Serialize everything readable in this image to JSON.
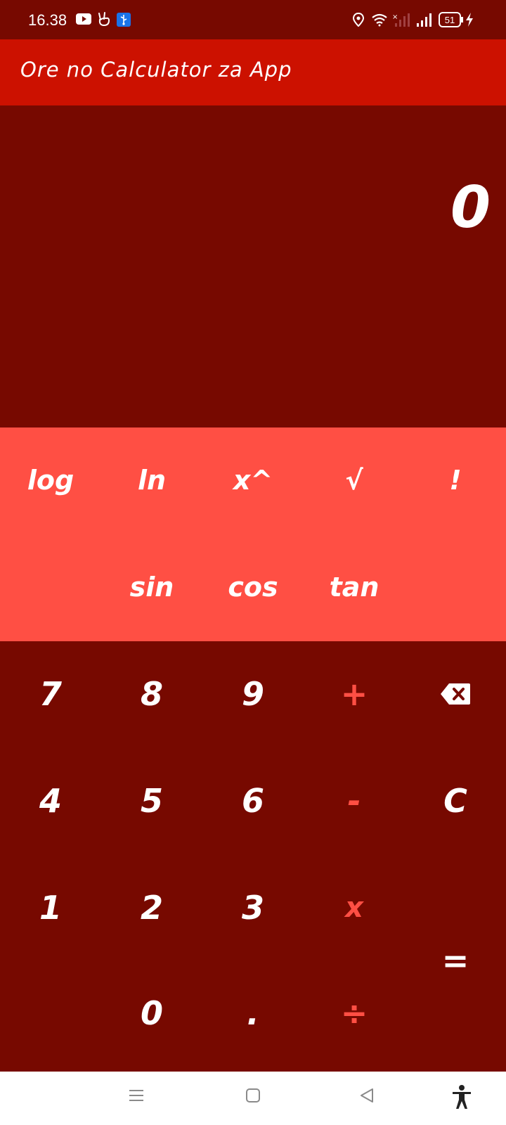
{
  "status_bar": {
    "time": "16.38",
    "battery": "51",
    "icons": [
      "youtube-icon",
      "peace-hand-icon",
      "usb-icon",
      "location-icon",
      "wifi-icon",
      "no-signal-icon",
      "signal-icon",
      "battery-icon",
      "charging-icon"
    ]
  },
  "app_bar": {
    "title": "Ore no Calculator za App"
  },
  "display": {
    "value": "0"
  },
  "scientific_keys": {
    "log": "log",
    "ln": "ln",
    "pow": "x^",
    "sqrt": "√",
    "fact": "!",
    "sin": "sin",
    "cos": "cos",
    "tan": "tan"
  },
  "keypad": {
    "k7": "7",
    "k8": "8",
    "k9": "9",
    "plus": "+",
    "backspace": "backspace-icon",
    "k4": "4",
    "k5": "5",
    "k6": "6",
    "minus": "-",
    "clear": "C",
    "k1": "1",
    "k2": "2",
    "k3": "3",
    "multiply": "x",
    "equals": "=",
    "k0": "0",
    "dot": ".",
    "divide": "÷"
  },
  "nav_bar": {
    "icons": [
      "menu-icon",
      "home-icon",
      "back-icon",
      "accessibility-icon"
    ]
  },
  "colors": {
    "background": "#770900",
    "app_bar": "#cc1100",
    "scientific_panel": "#ff4f44",
    "operator_text": "#ff4f44",
    "text": "#ffffff"
  }
}
